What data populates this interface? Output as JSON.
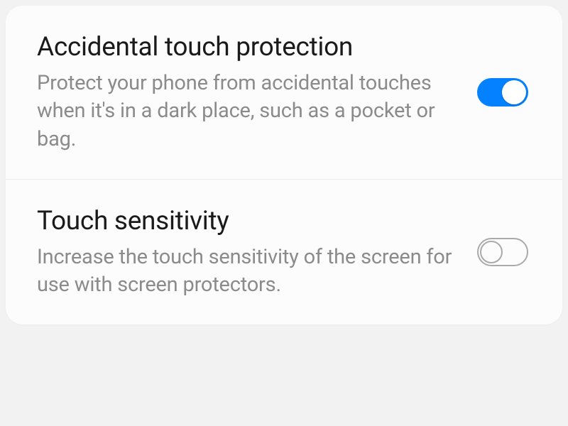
{
  "settings": [
    {
      "id": "accidental-touch-protection",
      "title": "Accidental touch protection",
      "description": "Protect your phone from accidental touches when it's in a dark place, such as a pocket or bag.",
      "enabled": true
    },
    {
      "id": "touch-sensitivity",
      "title": "Touch sensitivity",
      "description": "Increase the touch sensitivity of the screen for use with screen protectors.",
      "enabled": false
    }
  ],
  "colors": {
    "accent": "#0381fe",
    "text_primary": "#1a1a1a",
    "text_secondary": "#8b8b8b"
  }
}
